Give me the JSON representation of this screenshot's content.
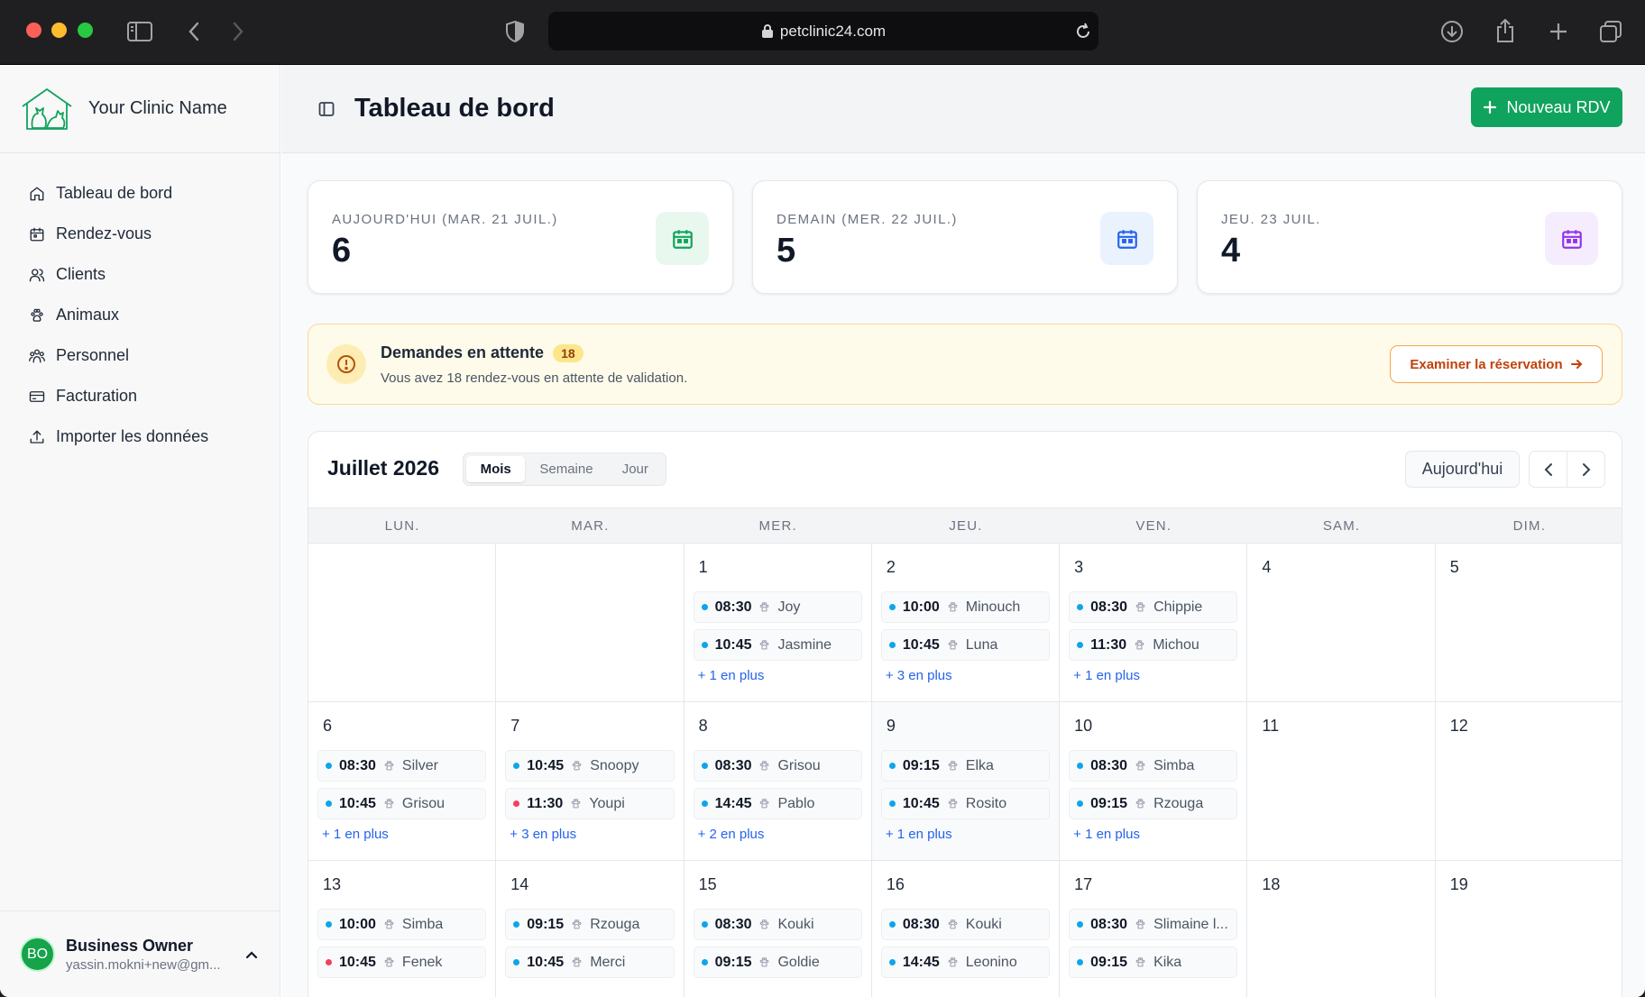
{
  "browser": {
    "url": "petclinic24.com"
  },
  "sidebar": {
    "clinic_name": "Your Clinic Name",
    "items": [
      {
        "label": "Tableau de bord",
        "icon": "home-icon"
      },
      {
        "label": "Rendez-vous",
        "icon": "calendar-icon"
      },
      {
        "label": "Clients",
        "icon": "users-icon"
      },
      {
        "label": "Animaux",
        "icon": "paw-icon"
      },
      {
        "label": "Personnel",
        "icon": "staff-icon"
      },
      {
        "label": "Facturation",
        "icon": "credit-card-icon"
      },
      {
        "label": "Importer les données",
        "icon": "upload-icon"
      }
    ],
    "user": {
      "initials": "BO",
      "name": "Business Owner",
      "email": "yassin.mokni+new@gm..."
    }
  },
  "header": {
    "title": "Tableau de bord",
    "new_button": "Nouveau RDV"
  },
  "stats": [
    {
      "label": "AUJOURD'HUI (MAR. 21 JUIL.)",
      "value": "6",
      "color": "#10a35d"
    },
    {
      "label": "DEMAIN (MER. 22 JUIL.)",
      "value": "5",
      "color": "#2563eb"
    },
    {
      "label": "JEU. 23 JUIL.",
      "value": "4",
      "color": "#9333ea"
    }
  ],
  "pending": {
    "title": "Demandes en attente",
    "count": "18",
    "subtitle": "Vous avez 18 rendez-vous en attente de validation.",
    "button": "Examiner la réservation"
  },
  "calendar": {
    "title": "Juillet 2026",
    "views": [
      "Mois",
      "Semaine",
      "Jour"
    ],
    "active_view": "Mois",
    "today_button": "Aujourd'hui",
    "weekdays": [
      "LUN.",
      "MAR.",
      "MER.",
      "JEU.",
      "VEN.",
      "SAM.",
      "DIM."
    ],
    "weeks": [
      [
        {
          "day": "",
          "events": []
        },
        {
          "day": "",
          "events": []
        },
        {
          "day": "1",
          "events": [
            {
              "time": "08:30",
              "name": "Joy",
              "status": "confirmed"
            },
            {
              "time": "10:45",
              "name": "Jasmine",
              "status": "confirmed"
            }
          ],
          "more": "+ 1 en plus"
        },
        {
          "day": "2",
          "events": [
            {
              "time": "10:00",
              "name": "Minouch",
              "status": "confirmed"
            },
            {
              "time": "10:45",
              "name": "Luna",
              "status": "confirmed"
            }
          ],
          "more": "+ 3 en plus"
        },
        {
          "day": "3",
          "events": [
            {
              "time": "08:30",
              "name": "Chippie",
              "status": "confirmed"
            },
            {
              "time": "11:30",
              "name": "Michou",
              "status": "confirmed"
            }
          ],
          "more": "+ 1 en plus"
        },
        {
          "day": "4",
          "events": []
        },
        {
          "day": "5",
          "events": []
        }
      ],
      [
        {
          "day": "6",
          "events": [
            {
              "time": "08:30",
              "name": "Silver",
              "status": "confirmed"
            },
            {
              "time": "10:45",
              "name": "Grisou",
              "status": "confirmed"
            }
          ],
          "more": "+ 1 en plus"
        },
        {
          "day": "7",
          "events": [
            {
              "time": "10:45",
              "name": "Snoopy",
              "status": "confirmed"
            },
            {
              "time": "11:30",
              "name": "Youpi",
              "status": "cancelled"
            }
          ],
          "more": "+ 3 en plus"
        },
        {
          "day": "8",
          "events": [
            {
              "time": "08:30",
              "name": "Grisou",
              "status": "confirmed"
            },
            {
              "time": "14:45",
              "name": "Pablo",
              "status": "confirmed"
            }
          ],
          "more": "+ 2 en plus"
        },
        {
          "day": "9",
          "events": [
            {
              "time": "09:15",
              "name": "Elka",
              "status": "confirmed"
            },
            {
              "time": "10:45",
              "name": "Rosito",
              "status": "confirmed"
            }
          ],
          "more": "+ 1 en plus",
          "highlight": true
        },
        {
          "day": "10",
          "events": [
            {
              "time": "08:30",
              "name": "Simba",
              "status": "confirmed"
            },
            {
              "time": "09:15",
              "name": "Rzouga",
              "status": "confirmed"
            }
          ],
          "more": "+ 1 en plus"
        },
        {
          "day": "11",
          "events": []
        },
        {
          "day": "12",
          "events": []
        }
      ],
      [
        {
          "day": "13",
          "events": [
            {
              "time": "10:00",
              "name": "Simba",
              "status": "confirmed"
            },
            {
              "time": "10:45",
              "name": "Fenek",
              "status": "cancelled"
            }
          ]
        },
        {
          "day": "14",
          "events": [
            {
              "time": "09:15",
              "name": "Rzouga",
              "status": "confirmed"
            },
            {
              "time": "10:45",
              "name": "Merci",
              "status": "confirmed"
            }
          ]
        },
        {
          "day": "15",
          "events": [
            {
              "time": "08:30",
              "name": "Kouki",
              "status": "confirmed"
            },
            {
              "time": "09:15",
              "name": "Goldie",
              "status": "confirmed"
            }
          ]
        },
        {
          "day": "16",
          "events": [
            {
              "time": "08:30",
              "name": "Kouki",
              "status": "confirmed"
            },
            {
              "time": "14:45",
              "name": "Leonino",
              "status": "confirmed"
            }
          ]
        },
        {
          "day": "17",
          "events": [
            {
              "time": "08:30",
              "name": "Slimaine l...",
              "status": "confirmed"
            },
            {
              "time": "09:15",
              "name": "Kika",
              "status": "confirmed"
            }
          ]
        },
        {
          "day": "18",
          "events": []
        },
        {
          "day": "19",
          "events": []
        }
      ]
    ]
  },
  "colors": {
    "confirmed": "#0ea5e9",
    "cancelled": "#f43f5e",
    "accent": "#10a35d"
  }
}
